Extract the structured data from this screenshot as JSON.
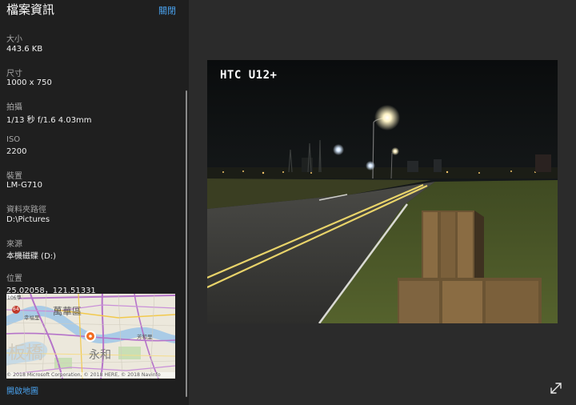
{
  "panel": {
    "title": "檔案資訊",
    "close_label": "關閉",
    "fields": [
      {
        "label": "大小",
        "value": "443.6 KB"
      },
      {
        "label": "尺寸",
        "value": "1000 x 750"
      },
      {
        "label": "拍攝",
        "value": "1/13 秒 f/1.6 4.03mm"
      },
      {
        "label": "ISO",
        "value": "2200"
      },
      {
        "label": "裝置",
        "value": "LM-G710"
      },
      {
        "label": "資料夾路徑",
        "value": "D:\\Pictures"
      },
      {
        "label": "來源",
        "value": "本機磁碟 (D:)"
      },
      {
        "label": "位置",
        "value": "25.02058，121.51331"
      }
    ],
    "map": {
      "labels": {
        "district_wanhua": "萬華區",
        "district_yonghe": "永和",
        "banqiao": "板橋",
        "xingya": "幸福里",
        "road_106": "106甲",
        "road_64": "64",
        "tianqi": "芳和里"
      },
      "copyright": "© 2018 Microsoft Corporation, © 2018 HERE, © 2018 Navinfo",
      "pin_color": "#f26d21"
    },
    "open_map_label": "開啟地圖"
  },
  "photo": {
    "watermark": "HTC U12+"
  },
  "icons": {
    "expand": "expand-icon"
  }
}
